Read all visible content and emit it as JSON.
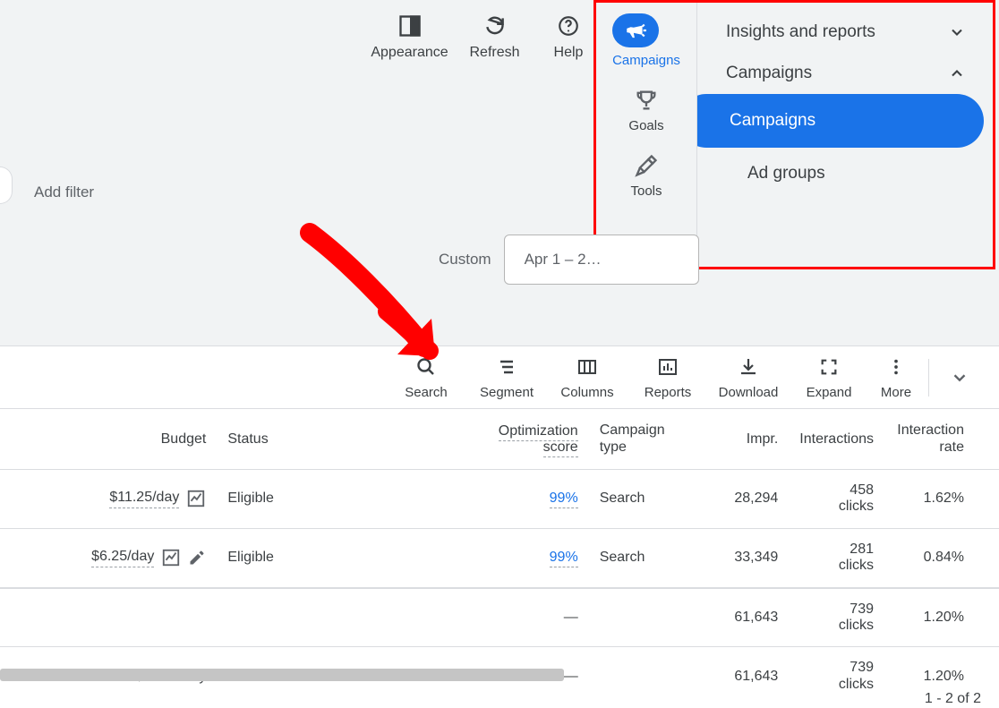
{
  "topTools": {
    "appearance": "Appearance",
    "refresh": "Refresh",
    "help": "Help"
  },
  "redPanel": {
    "left": {
      "campaigns": "Campaigns",
      "goals": "Goals",
      "tools": "Tools"
    },
    "right": {
      "insights": "Insights and reports",
      "campaigns": "Campaigns",
      "selected": "Campaigns",
      "adgroups": "Ad groups"
    }
  },
  "addFilter": "Add filter",
  "dateRow": {
    "custom": "Custom",
    "range": "Apr 1 – 2…"
  },
  "tableTools": {
    "search": "Search",
    "segment": "Segment",
    "columns": "Columns",
    "reports": "Reports",
    "download": "Download",
    "expand": "Expand",
    "more": "More"
  },
  "headers": {
    "budget": "Budget",
    "status": "Status",
    "opt": "Optimization",
    "opt2": "score",
    "ctype1": "Campaign",
    "ctype2": "type",
    "impr": "Impr.",
    "inter": "Interactions",
    "irate1": "Interaction",
    "irate2": "rate"
  },
  "rows": [
    {
      "budget": "$11.25/day",
      "editable": true,
      "status": "Eligible",
      "opt": "99%",
      "ctype": "Search",
      "impr": "28,294",
      "inter_v": "458",
      "inter_u": "clicks",
      "irate": "1.62%"
    },
    {
      "budget": "$6.25/day",
      "editable": true,
      "pencil": true,
      "status": "Eligible",
      "opt": "99%",
      "ctype": "Search",
      "impr": "33,349",
      "inter_v": "281",
      "inter_u": "clicks",
      "irate": "0.84%"
    },
    {
      "budget": "",
      "editable": false,
      "status": "",
      "opt": "—",
      "ctype": "",
      "impr": "61,643",
      "inter_v": "739",
      "inter_u": "clicks",
      "irate": "1.20%"
    },
    {
      "budget": "CA$17.50/day",
      "editable": false,
      "status": "",
      "opt": "—",
      "ctype": "",
      "impr": "61,643",
      "inter_v": "739",
      "inter_u": "clicks",
      "irate": "1.20%"
    }
  ],
  "pagination": "1 - 2 of 2"
}
